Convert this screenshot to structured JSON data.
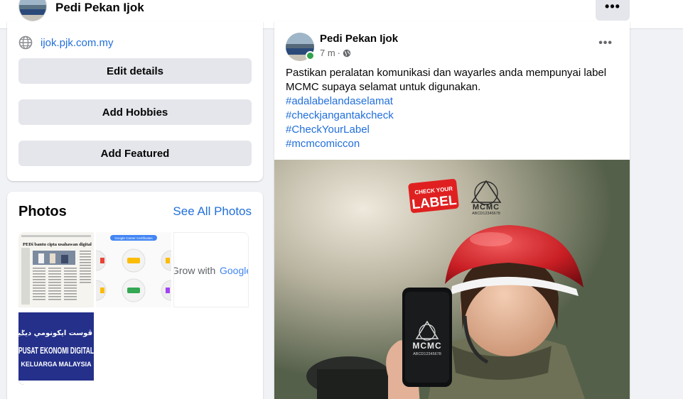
{
  "topbar": {
    "page_name": "Pedi Pekan Ijok",
    "more_label": "•••"
  },
  "intro": {
    "website": "ijok.pjk.com.my",
    "buttons": {
      "edit_details": "Edit details",
      "add_hobbies": "Add Hobbies",
      "add_featured": "Add Featured"
    }
  },
  "photos": {
    "title": "Photos",
    "see_all": "See All Photos",
    "thumb1_headline": "PEDi bantu cipta usahawan digital",
    "thumb2_banner": "Google Career Certificates",
    "thumb3_text_left": "Grow with ",
    "thumb3_text_google": "Google",
    "thumb4_arabic": "ڤوست ايكونومي ديݢيتل كلوارݢ",
    "thumb4_line1": "PUSAT EKONOMI DIGITAL",
    "thumb4_line2": "KELUARGA MALAYSIA"
  },
  "post": {
    "author": "Pedi Pekan Ijok",
    "time": "7 m",
    "separator": "·",
    "more_label": "•••",
    "text": "Pastikan peralatan komunikasi dan wayarles anda mempunyai label MCMC supaya selamat untuk digunakan.",
    "hashtags": [
      "#adalabelandaselamat",
      "#checkjangantakcheck",
      "#CheckYourLabel",
      "#mcmcomiccon"
    ],
    "image": {
      "badge_top": "CHECK YOUR",
      "badge_main": "LABEL",
      "logo_text": "MCMC",
      "logo_code": "ABCD12345678",
      "phone_text": "MCMC",
      "phone_code": "ABCD12345678"
    }
  },
  "colors": {
    "link": "#216fdb",
    "button_bg": "#e4e6eb",
    "page_bg": "#f0f2f5",
    "online": "#31a24c",
    "badge_red": "#e02020"
  },
  "icons": [
    "globe-icon",
    "more-icon",
    "public-globe-icon"
  ]
}
